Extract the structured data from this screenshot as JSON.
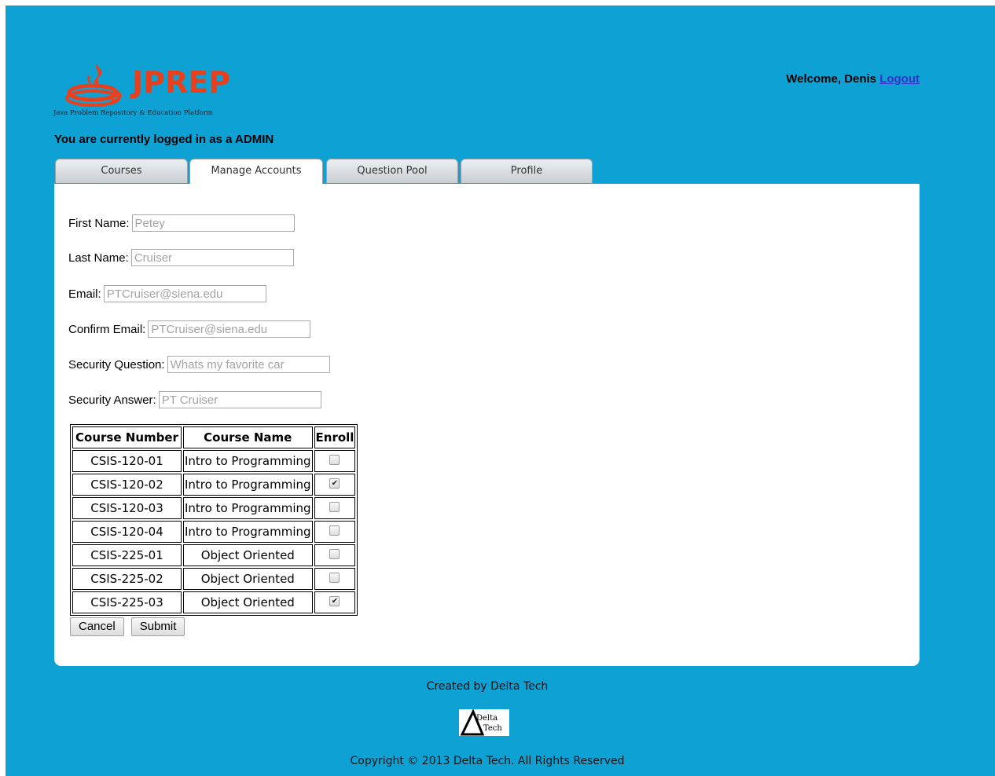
{
  "brand": {
    "name": "JPREP",
    "tagline": "Java Problem Repository & Education Platform",
    "accent_color": "#e8401c",
    "background_color": "#0ea2d4",
    "logo_icon": "java-flame-cup-icon"
  },
  "header": {
    "welcome_text": "Welcome, Denis",
    "logout_label": "Logout",
    "role_text": "You are currently logged in as a ADMIN"
  },
  "tabs": [
    {
      "label": "Courses",
      "active": false
    },
    {
      "label": "Manage Accounts",
      "active": true
    },
    {
      "label": "Question Pool",
      "active": false
    },
    {
      "label": "Profile",
      "active": false
    }
  ],
  "form": {
    "first_name": {
      "label": "First Name:",
      "value": "",
      "placeholder": "Petey"
    },
    "last_name": {
      "label": "Last Name:",
      "value": "",
      "placeholder": "Cruiser"
    },
    "email": {
      "label": "Email:",
      "value": "",
      "placeholder": "PTCruiser@siena.edu"
    },
    "confirm_email": {
      "label": "Confirm Email:",
      "value": "",
      "placeholder": "PTCruiser@siena.edu"
    },
    "security_question": {
      "label": "Security Question:",
      "value": "",
      "placeholder": "Whats my favorite car"
    },
    "security_answer": {
      "label": "Security Answer:",
      "value": "",
      "placeholder": "PT Cruiser"
    }
  },
  "courses_table": {
    "headers": [
      "Course Number",
      "Course Name",
      "Enroll"
    ],
    "rows": [
      {
        "number": "CSIS-120-01",
        "name": "Intro to Programming",
        "enrolled": false
      },
      {
        "number": "CSIS-120-02",
        "name": "Intro to Programming",
        "enrolled": true
      },
      {
        "number": "CSIS-120-03",
        "name": "Intro to Programming",
        "enrolled": false
      },
      {
        "number": "CSIS-120-04",
        "name": "Intro to Programming",
        "enrolled": false
      },
      {
        "number": "CSIS-225-01",
        "name": "Object Oriented",
        "enrolled": false
      },
      {
        "number": "CSIS-225-02",
        "name": "Object Oriented",
        "enrolled": false
      },
      {
        "number": "CSIS-225-03",
        "name": "Object Oriented",
        "enrolled": true
      }
    ]
  },
  "actions": {
    "cancel_label": "Cancel",
    "submit_label": "Submit"
  },
  "footer": {
    "created_by": "Created by Delta Tech",
    "logo_text_line1": "Delta",
    "logo_text_line2": "Tech",
    "copyright": "Copyright © 2013 Delta Tech. All Rights Reserved"
  }
}
